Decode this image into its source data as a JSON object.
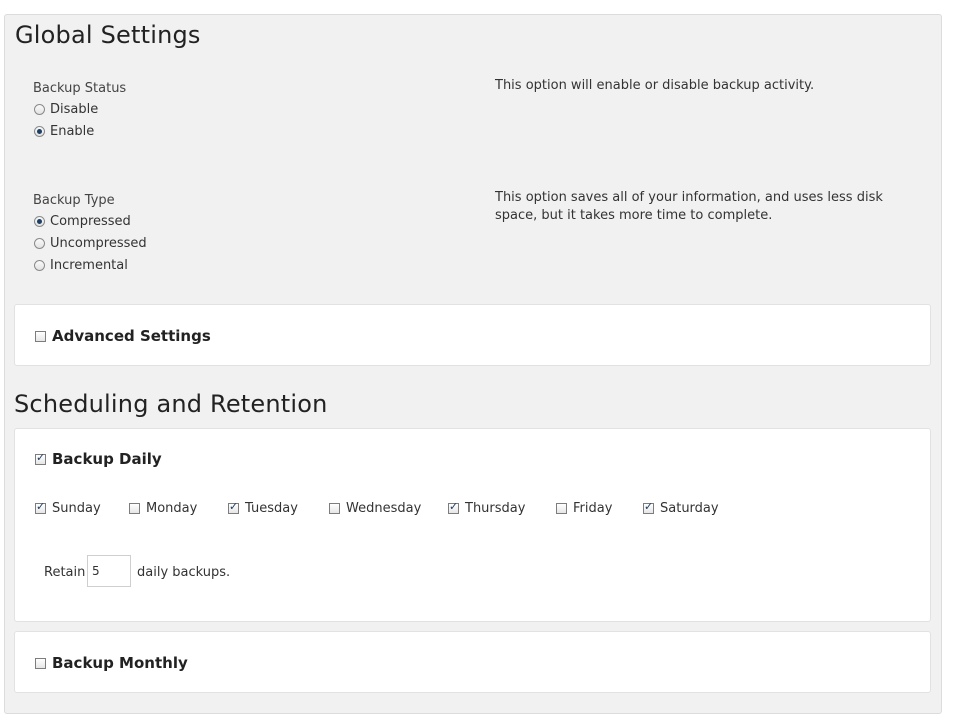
{
  "global": {
    "title": "Global Settings",
    "backup_status": {
      "label": "Backup Status",
      "options": [
        "Disable",
        "Enable"
      ],
      "selected": "Enable",
      "description": "This option will enable or disable backup activity."
    },
    "backup_type": {
      "label": "Backup Type",
      "options": [
        "Compressed",
        "Uncompressed",
        "Incremental"
      ],
      "selected": "Compressed",
      "description": "This option saves all of your information, and uses less disk space, but it takes more time to complete."
    },
    "advanced": {
      "label": "Advanced Settings",
      "checked": false
    }
  },
  "scheduling": {
    "title": "Scheduling and Retention",
    "daily": {
      "label": "Backup Daily",
      "checked": true,
      "days": [
        {
          "label": "Sunday",
          "checked": true
        },
        {
          "label": "Monday",
          "checked": false
        },
        {
          "label": "Tuesday",
          "checked": true
        },
        {
          "label": "Wednesday",
          "checked": false
        },
        {
          "label": "Thursday",
          "checked": true
        },
        {
          "label": "Friday",
          "checked": false
        },
        {
          "label": "Saturday",
          "checked": true
        }
      ],
      "retain_label": "Retain",
      "retain_value": "5",
      "retain_suffix": "daily backups."
    },
    "monthly": {
      "label": "Backup Monthly",
      "checked": false
    }
  }
}
